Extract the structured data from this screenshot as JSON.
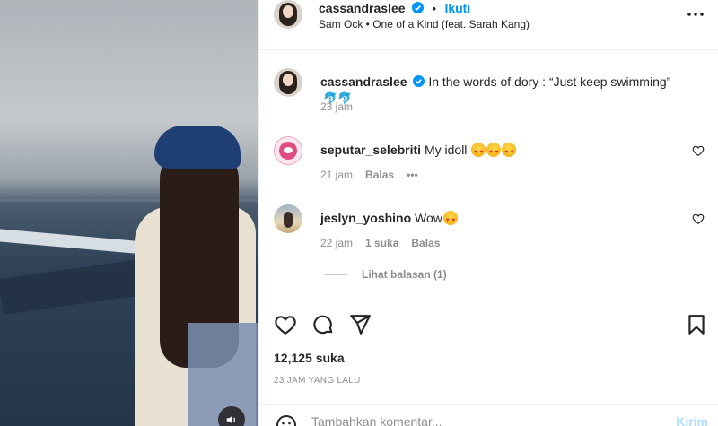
{
  "post": {
    "author": "cassandraslee",
    "follow_label": "Ikuti",
    "separator": "•",
    "audio": "Sam Ock • One of a Kind (feat. Sarah Kang)",
    "caption": {
      "user": "cassandraslee",
      "text": "In the words of dory : “Just keep swimming”",
      "time": "23 jam"
    }
  },
  "comments": [
    {
      "user": "seputar_selebriti",
      "text": "My idoll",
      "time": "21 jam",
      "reply_label": "Balas",
      "more_label": "•••"
    },
    {
      "user": "jeslyn_yoshino",
      "text": "Wow",
      "time": "22 jam",
      "likes": "1 suka",
      "reply_label": "Balas",
      "view_replies": "Lihat balasan (1)"
    }
  ],
  "footer": {
    "likes": "12,125 suka",
    "posted": "23 JAM YANG LALU",
    "comment_placeholder": "Tambahkan komentar...",
    "post_label": "Kirim"
  },
  "colors": {
    "accent": "#0095f6",
    "text": "#262626",
    "muted": "#8e8e8e"
  }
}
